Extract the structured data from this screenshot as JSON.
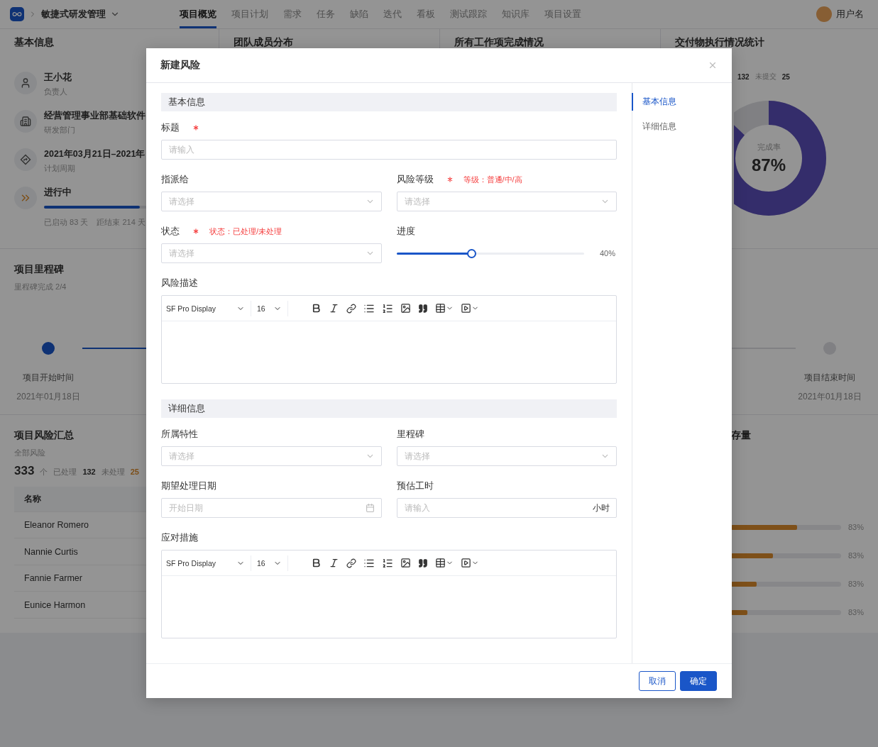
{
  "nav": {
    "product": "敏捷式研发管理",
    "tabs": [
      {
        "label": "项目概览",
        "selected": true
      },
      {
        "label": "项目计划",
        "selected": false
      },
      {
        "label": "需求",
        "selected": false
      },
      {
        "label": "任务",
        "selected": false
      },
      {
        "label": "缺陷",
        "selected": false
      },
      {
        "label": "迭代",
        "selected": false
      },
      {
        "label": "看板",
        "selected": false
      },
      {
        "label": "测试跟踪",
        "selected": false
      },
      {
        "label": "知识库",
        "selected": false
      },
      {
        "label": "项目设置",
        "selected": false
      }
    ],
    "user": "用户名"
  },
  "basic_info": {
    "title": "基本信息",
    "items": [
      {
        "kind": "person",
        "value": "王小花",
        "caption": "负责人"
      },
      {
        "kind": "building",
        "value": "经营管理事业部基础软件",
        "caption": "研发部门"
      },
      {
        "kind": "route",
        "value": "2021年03月21日–2021年",
        "caption": "计划周期"
      }
    ],
    "status": {
      "value": "进行中",
      "level": 0.93,
      "started": "已启动 83 天",
      "remaining": "距结束 214 天"
    }
  },
  "team": {
    "title": "团队成员分布"
  },
  "work_items": {
    "title": "所有工作项完成情况"
  },
  "delivery": {
    "title": "交付物执行情况统计",
    "legend": [
      {
        "count": "132"
      },
      {
        "label": "未提交",
        "count": "25"
      }
    ],
    "completion": {
      "label": "完成率",
      "value": "87%"
    }
  },
  "milestones": {
    "title": "项目里程碑",
    "subtitle": "里程碑完成 2/4",
    "points": [
      {
        "label": "项目开始时间",
        "date": "2021年01月18日",
        "done": true
      },
      {
        "label": "项目结束时间",
        "date": "2021年01月18日",
        "done": false
      }
    ]
  },
  "risks": {
    "title": "项目风险汇总",
    "subtitle": "全部风险",
    "total": "333",
    "unit": "个",
    "handled_label": "已处理",
    "handled": "132",
    "pending_label": "未处理",
    "pending": "25",
    "columns": [
      "名称"
    ],
    "rows": [
      "Eleanor Romero",
      "Nannie Curtis",
      "Fannie Farmer",
      "Eunice Harmon"
    ]
  },
  "stock": {
    "title": "存量",
    "bars": [
      {
        "level": 0.6,
        "reading": "83%"
      },
      {
        "level": 0.38,
        "reading": "83%"
      },
      {
        "level": 0.23,
        "reading": "83%"
      },
      {
        "level": 0.15,
        "reading": "83%"
      }
    ]
  },
  "modal": {
    "title": "新建风险",
    "nav": [
      {
        "label": "基本信息",
        "selected": true
      },
      {
        "label": "详细信息",
        "selected": false
      }
    ],
    "sections": [
      {
        "title": "基本信息",
        "rows": [
          [
            {
              "kind": "input",
              "label": "标题",
              "required": true,
              "placeholder": "请输入"
            }
          ],
          [
            {
              "kind": "select",
              "label": "指派给",
              "required": false,
              "placeholder": "请选择"
            },
            {
              "kind": "select",
              "label": "风险等级",
              "required": true,
              "hint": "等级：普通/中/高",
              "placeholder": "请选择"
            }
          ],
          [
            {
              "kind": "select",
              "label": "状态",
              "required": true,
              "hint": "状态：已处理/未处理",
              "placeholder": "请选择"
            },
            {
              "kind": "slider",
              "label": "进度",
              "required": false,
              "level": 0.4,
              "reading": "40%"
            }
          ],
          [
            {
              "kind": "editor",
              "label": "风险描述",
              "required": false,
              "font": "SF Pro Display",
              "size": "16"
            }
          ]
        ]
      },
      {
        "title": "详细信息",
        "rows": [
          [
            {
              "kind": "select",
              "label": "所属特性",
              "required": false,
              "placeholder": "请选择"
            },
            {
              "kind": "select",
              "label": "里程碑",
              "required": false,
              "placeholder": "请选择"
            }
          ],
          [
            {
              "kind": "date",
              "label": "期望处理日期",
              "required": false,
              "placeholder": "开始日期"
            },
            {
              "kind": "unit-input",
              "label": "预估工时",
              "required": false,
              "placeholder": "请输入",
              "unit": "小时"
            }
          ],
          [
            {
              "kind": "editor",
              "label": "应对措施",
              "required": false,
              "font": "SF Pro Display",
              "size": "16"
            }
          ]
        ]
      }
    ],
    "buttons": [
      {
        "label": "取消",
        "kind": "secondary"
      },
      {
        "label": "确定",
        "kind": "primary"
      }
    ]
  }
}
